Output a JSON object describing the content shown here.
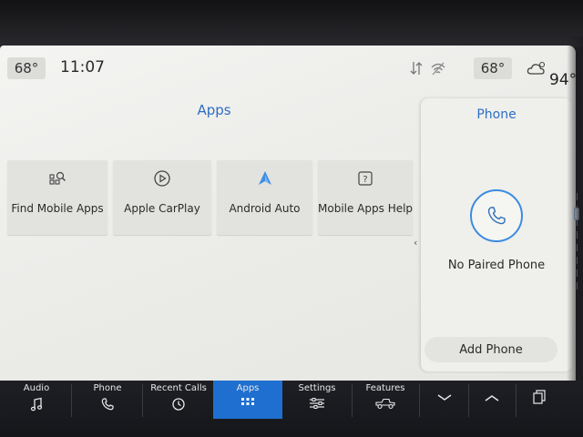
{
  "status_bar": {
    "left_temp": "68°",
    "clock": "11:07",
    "right_temp": "68°",
    "outside_temp": "94°"
  },
  "apps": {
    "title": "Apps",
    "tiles": [
      {
        "label": "Find Mobile Apps",
        "icon": "find-apps-icon"
      },
      {
        "label": "Apple CarPlay",
        "icon": "carplay-icon"
      },
      {
        "label": "Android Auto",
        "icon": "android-auto-icon"
      },
      {
        "label": "Mobile Apps Help",
        "icon": "help-icon"
      }
    ]
  },
  "phone_panel": {
    "title": "Phone",
    "status": "No Paired Phone",
    "add_button": "Add Phone"
  },
  "nav": {
    "items": [
      {
        "label": "Audio",
        "icon": "music-note-icon"
      },
      {
        "label": "Phone",
        "icon": "phone-icon"
      },
      {
        "label": "Recent Calls",
        "icon": "history-icon"
      },
      {
        "label": "Apps",
        "icon": "grid-icon"
      },
      {
        "label": "Settings",
        "icon": "sliders-icon"
      },
      {
        "label": "Features",
        "icon": "truck-icon"
      }
    ],
    "active": "Apps"
  },
  "colors": {
    "accent": "#2d6fc4",
    "nav_active": "#1f6fd0",
    "nav_bg": "#1e1f24",
    "screen_bg": "#efefec"
  }
}
